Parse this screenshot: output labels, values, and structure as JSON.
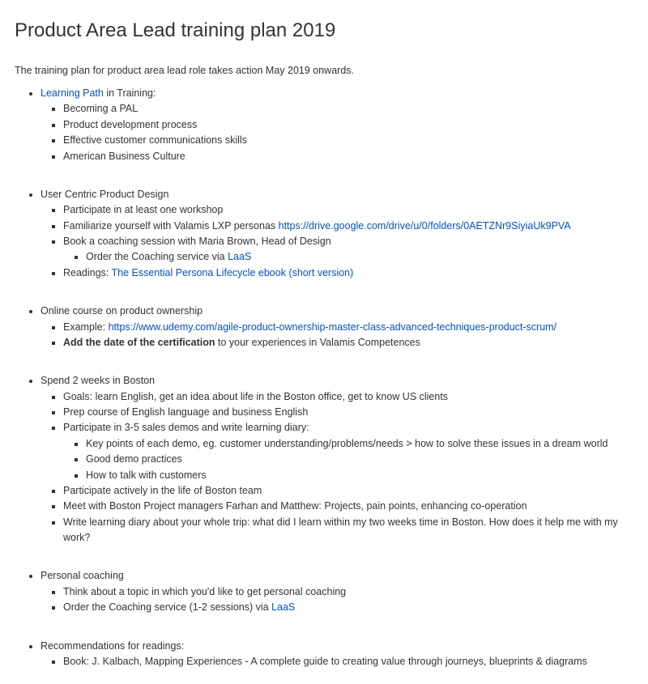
{
  "title": "Product Area Lead training plan 2019",
  "intro": "The training plan for product area lead role takes action May 2019 onwards.",
  "sections": {
    "learningPath": {
      "link": "Learning Path",
      "suffix": " in Training:",
      "items": {
        "a": "Becoming a PAL",
        "b": "Product development process",
        "c": "Effective customer communications skills",
        "d": "American Business Culture"
      }
    },
    "ucpd": {
      "heading": "User Centric Product Design",
      "a": "Participate in at least one workshop",
      "bPrefix": "Familiarize yourself with Valamis LXP personas ",
      "bLink": "https://drive.google.com/drive/u/0/folders/0AETZNr9SiyiaUk9PVA",
      "cPrefix": "Book a coaching session with ",
      "cAfter": "Maria Brown, Head of Design",
      "cSubPrefix": "Order the Coaching service via ",
      "cSubLink": "LaaS",
      "dPrefix": "Readings: ",
      "dLink": "The Essential Persona Lifecycle ebook (short version)"
    },
    "onlineCourse": {
      "heading": "Online course on product ownership",
      "aPrefix": "Example: ",
      "aLink": "https://www.udemy.com/agile-product-ownership-master-class-advanced-techniques-product-scrum/",
      "bBold": "Add the date of the certification",
      "bAfter": " to your experiences in Valamis Competences"
    },
    "boston": {
      "heading": "Spend 2 weeks in Boston",
      "a": "Goals: learn English, get an idea about life in the Boston office, get to know US clients",
      "b": "Prep course of English language and business English",
      "c": "Participate in 3-5 sales demos and write learning diary:",
      "cSub": {
        "i": "Key points of each demo, eg. customer understanding/problems/needs > how to solve these issues in a dream world",
        "ii": "Good demo practices",
        "iii": "How to talk with customers"
      },
      "d": "Participate actively in the life of Boston team",
      "e": "Meet with Boston Project managers Farhan and Matthew: Projects, pain points, enhancing co-operation",
      "f": "Write learning diary about your whole trip: what did I learn within my two weeks time in Boston. How does it help me with my work?"
    },
    "coaching": {
      "heading": "Personal coaching",
      "a": "Think about a topic in which you'd like to get personal coaching",
      "bPrefix": "Order the Coaching service (1-2 sessions) via ",
      "bLink": "LaaS"
    },
    "readings": {
      "heading": "Recommendations for readings:",
      "a": "Book: J. Kalbach, Mapping Experiences - A complete guide to creating value through journeys, blueprints & diagrams"
    }
  }
}
